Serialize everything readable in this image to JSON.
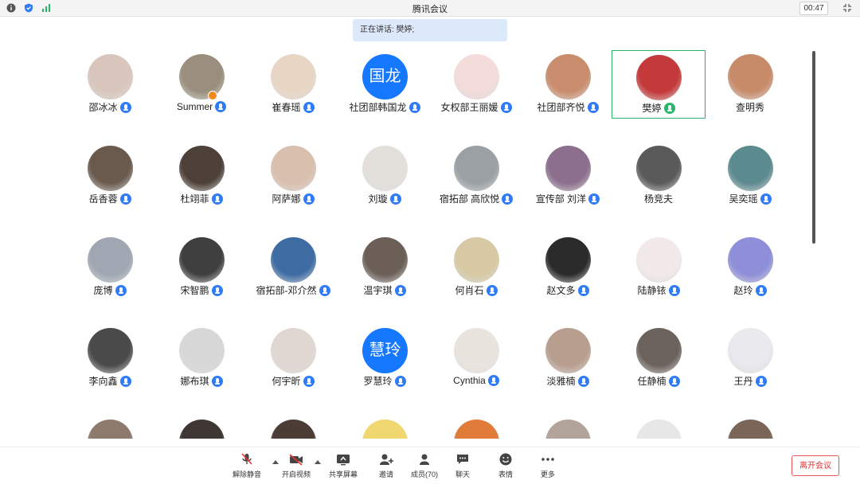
{
  "window": {
    "title": "腾讯会议",
    "timer": "00:47"
  },
  "speaking": "正在讲话: 樊婷;",
  "participants": [
    {
      "name": "邵冰冰",
      "color": "#d8c6bc",
      "mic": "blue"
    },
    {
      "name": "Summer",
      "color": "#9a8f7e",
      "mic": "blue",
      "host": true
    },
    {
      "name": "崔春瑶",
      "color": "#e8d6c5",
      "mic": "blue"
    },
    {
      "name": "社团部韩国龙",
      "text": "国龙",
      "mic": "blue"
    },
    {
      "name": "女权部王丽媛",
      "color": "#f3dcd9",
      "mic": "blue"
    },
    {
      "name": "社团部齐悦",
      "color": "#c98c6c",
      "mic": "blue"
    },
    {
      "name": "樊婷",
      "color": "#c43a3a",
      "mic": "green",
      "active": true
    },
    {
      "name": "查明秀",
      "color": "#c78b6a",
      "mic": "none"
    },
    {
      "name": "岳香蓉",
      "color": "#6a5a4e",
      "mic": "blue"
    },
    {
      "name": "杜翊菲",
      "color": "#4d4038",
      "mic": "blue"
    },
    {
      "name": "阿萨娜",
      "color": "#d9bfae",
      "mic": "blue"
    },
    {
      "name": "刘璇",
      "color": "#e3e0dc",
      "mic": "blue"
    },
    {
      "name": "宿拓部 高欣悦",
      "color": "#9aa0a3",
      "mic": "blue"
    },
    {
      "name": "宣传部 刘洋",
      "color": "#8c6f8d",
      "mic": "blue"
    },
    {
      "name": "杨竞夫",
      "color": "#5a5a5a",
      "mic": "none"
    },
    {
      "name": "吴奕瑶",
      "color": "#5b8a8f",
      "mic": "blue"
    },
    {
      "name": "庞博",
      "color": "#9fa7b2",
      "mic": "blue"
    },
    {
      "name": "宋智鹏",
      "color": "#3f3f3f",
      "mic": "blue"
    },
    {
      "name": "宿拓部-邓介然",
      "color": "#3d6ba2",
      "mic": "blue"
    },
    {
      "name": "温宇琪",
      "color": "#6b5f58",
      "mic": "blue"
    },
    {
      "name": "何肖石",
      "color": "#d6c9a3",
      "mic": "blue"
    },
    {
      "name": "赵文多",
      "color": "#2b2b2b",
      "mic": "blue"
    },
    {
      "name": "陆静铱",
      "color": "#f2eaea",
      "mic": "blue"
    },
    {
      "name": "赵玲",
      "color": "#8e8fd8",
      "mic": "blue"
    },
    {
      "name": "李向鑫",
      "color": "#4a4a4a",
      "mic": "blue"
    },
    {
      "name": "娜布琪",
      "color": "#d7d7d7",
      "mic": "blue"
    },
    {
      "name": "何宇昕",
      "color": "#e0d7d2",
      "mic": "blue"
    },
    {
      "name": "罗慧玲",
      "text": "慧玲",
      "mic": "blue"
    },
    {
      "name": "Cynthia",
      "color": "#eae4df",
      "mic": "blue"
    },
    {
      "name": "淡雅楠",
      "color": "#b79e8e",
      "mic": "blue"
    },
    {
      "name": "任静楠",
      "color": "#6b625c",
      "mic": "blue"
    },
    {
      "name": "王丹",
      "color": "#e9e9ee",
      "mic": "blue"
    },
    {
      "name": "",
      "color": "#8e7a6c",
      "mic": "none"
    },
    {
      "name": "",
      "color": "#3e3733",
      "mic": "none"
    },
    {
      "name": "",
      "color": "#4b3c35",
      "mic": "none"
    },
    {
      "name": "",
      "color": "#f1d770",
      "mic": "none"
    },
    {
      "name": "",
      "color": "#e07b3a",
      "mic": "none"
    },
    {
      "name": "",
      "color": "#b2a49a",
      "mic": "none"
    },
    {
      "name": "",
      "color": "#e7e7e7",
      "mic": "none"
    },
    {
      "name": "",
      "color": "#7b6458",
      "mic": "none"
    }
  ],
  "toolbar": {
    "unmute": "解除静音",
    "video": "开启视频",
    "share": "共享屏幕",
    "invite": "邀请",
    "members": "成员(70)",
    "chat": "聊天",
    "emoji": "表情",
    "more": "更多",
    "leave": "离开会议"
  }
}
